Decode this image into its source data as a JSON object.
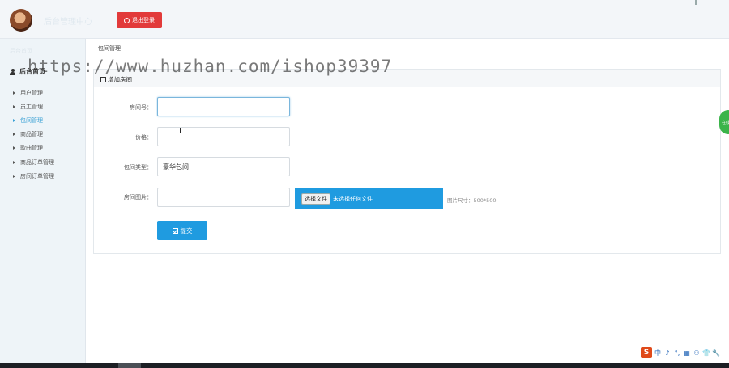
{
  "header": {
    "app_title": "后台管理中心",
    "logout_label": "退出登录",
    "colors": {
      "logout": "#e23a3a"
    }
  },
  "sidebar": {
    "head_label": "后台首页",
    "menu_header": "后台首页",
    "items": [
      {
        "label": "用户管理",
        "active": false
      },
      {
        "label": "员工管理",
        "active": false
      },
      {
        "label": "包间管理",
        "active": true
      },
      {
        "label": "商品管理",
        "active": false
      },
      {
        "label": "歌曲管理",
        "active": false
      },
      {
        "label": "商品订单管理",
        "active": false
      },
      {
        "label": "房间订单管理",
        "active": false
      }
    ]
  },
  "breadcrumb": "包间管理",
  "panel": {
    "title": "增加房间",
    "fields": {
      "room_no": {
        "label": "房间号：",
        "value": ""
      },
      "price": {
        "label": "价格：",
        "value": ""
      },
      "room_type": {
        "label": "包间类型：",
        "value": "豪华包间"
      },
      "room_image": {
        "label": "房间图片：",
        "choose_label": "选择文件",
        "status": "未选择任何文件",
        "size_hint": "图片尺寸：500*500"
      }
    },
    "submit_label": "提交"
  },
  "chat_bubble": "在线",
  "watermark": "https://www.huzhan.com/ishop39397",
  "ime": {
    "logo": "S",
    "items": [
      "中",
      "♪",
      "°,",
      "▦",
      "⚇",
      "👕",
      "🔧"
    ]
  },
  "colors": {
    "accent": "#1f9be0",
    "active_menu": "#3aa1d5"
  }
}
